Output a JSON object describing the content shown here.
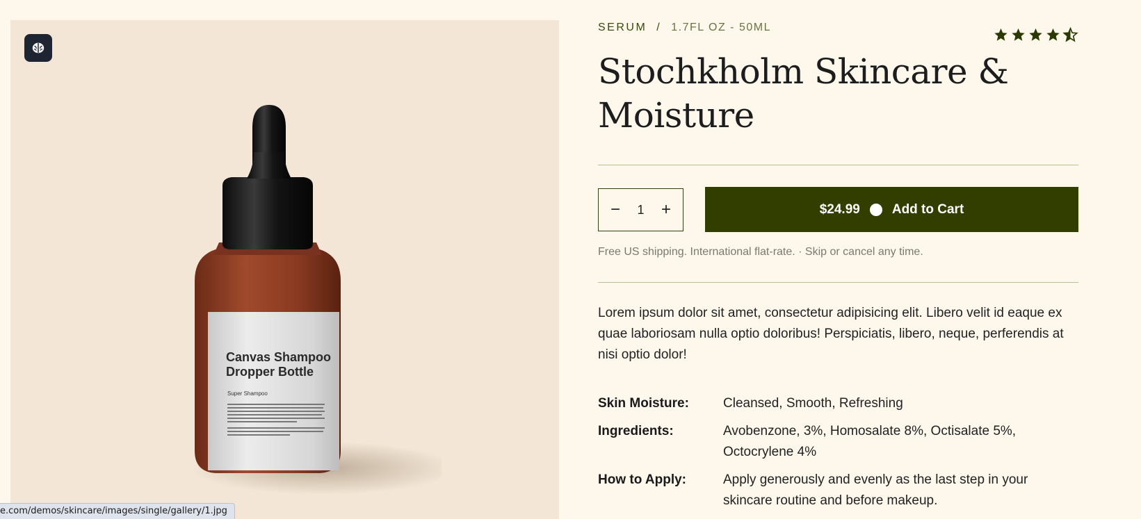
{
  "gallery": {
    "badge_icon": "brain-icon",
    "product_label": {
      "title": "Canvas Shampoo Dropper Bottle",
      "subtitle": "Super Shampoo"
    }
  },
  "status_bar": {
    "url": "e.com/demos/skincare/images/single/gallery/1.jpg"
  },
  "product": {
    "category": "SERUM",
    "separator": "/",
    "size": "1.7FL OZ - 50ML",
    "rating": 4.5,
    "title": "Stochkholm Skincare & Moisture",
    "quantity": {
      "decrement": "−",
      "value": "1",
      "increment": "+"
    },
    "price": "$24.99",
    "add_to_cart": "Add to Cart",
    "shipping": "Free US shipping. International flat-rate. · Skip or cancel any time.",
    "description": "Lorem ipsum dolor sit amet, consectetur adipisicing elit. Libero velit id eaque ex quae laboriosam nulla optio doloribus! Perspiciatis, libero, neque, perferendis at nisi optio dolor!",
    "specs": [
      {
        "label": "Skin Moisture:",
        "value": "Cleansed, Smooth, Refreshing"
      },
      {
        "label": "Ingredients:",
        "value": "Avobenzone, 3%, Homosalate 8%, Octisalate 5%, Octocrylene 4%"
      },
      {
        "label": "How to Apply:",
        "value": "Apply generously and evenly as the last step in your skincare routine and before makeup."
      }
    ]
  },
  "colors": {
    "page_bg": "#fdf7ec",
    "gallery_bg": "#f3e6d6",
    "accent": "#323e00",
    "star": "#2b3a05"
  }
}
